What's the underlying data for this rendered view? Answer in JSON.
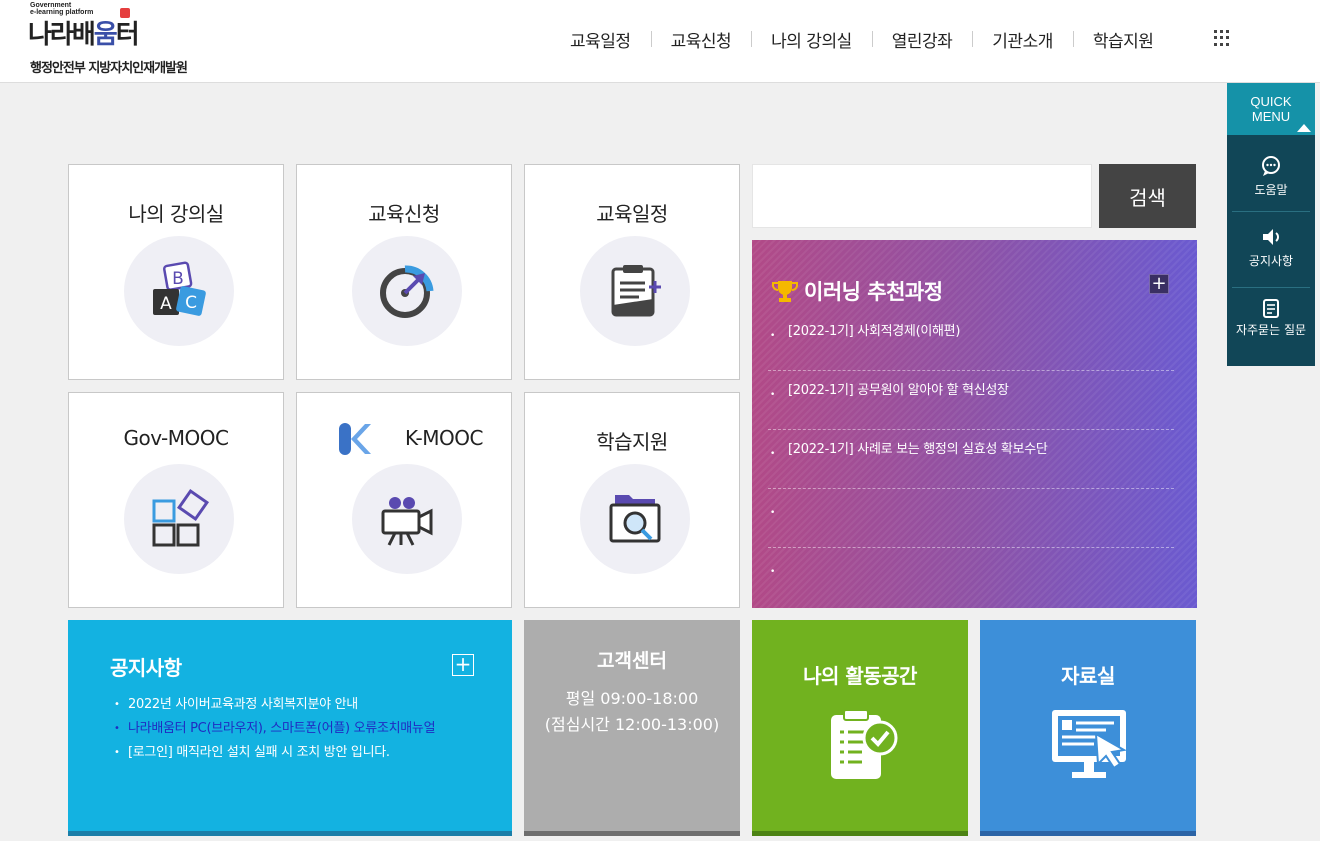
{
  "logo": {
    "sub_line1": "Government",
    "sub_line2": "e-learning platform",
    "name_part1": "나라배",
    "name_highlight": "움",
    "name_part2": "터",
    "org": "행정안전부 지방자치인재개발원"
  },
  "nav": {
    "items": [
      "교육일정",
      "교육신청",
      "나의 강의실",
      "열린강좌",
      "기관소개",
      "학습지원"
    ]
  },
  "tiles": [
    {
      "title": "나의 강의실"
    },
    {
      "title": "교육신청"
    },
    {
      "title": "교육일정"
    },
    {
      "title": "Gov-MOOC"
    },
    {
      "title": "K-MOOC"
    },
    {
      "title": "학습지원"
    }
  ],
  "abc_icon": {
    "a": "A",
    "b": "B",
    "c": "C"
  },
  "search": {
    "placeholder": "",
    "button_label": "검색"
  },
  "recommended": {
    "title": "이러닝 추천과정",
    "plus": "+",
    "items": [
      "[2022-1기] 사회적경제(이해편)",
      "[2022-1기] 공무원이 알아야 할 혁신성장",
      "[2022-1기] 사례로 보는 행정의 실효성 확보수단",
      "",
      ""
    ]
  },
  "notice": {
    "title": "공지사항",
    "plus": "+",
    "items": [
      "2022년 사이버교육과정 사회복지분야 안내",
      "나라배움터 PC(브라우저), 스마트폰(어플) 오류조치매뉴얼",
      "[로그인] 매직라인 설치 실패 시 조치 방안 입니다."
    ]
  },
  "customer_center": {
    "title": "고객센터",
    "hours_line1": "평일 09:00-18:00",
    "hours_line2": "(점심시간 12:00-13:00)"
  },
  "activity": {
    "title": "나의 활동공간"
  },
  "library": {
    "title": "자료실"
  },
  "quick_menu": {
    "title_line1": "QUICK",
    "title_line2": "MENU",
    "items": [
      "도움말",
      "공지사항",
      "자주묻는 질문"
    ]
  },
  "colors": {
    "notice_bg": "#13b2e1",
    "customer_bg": "#adadad",
    "activity_bg": "#71b21f",
    "library_bg": "#3d8fd9",
    "quickmenu_bg": "#114657",
    "quickmenu_head": "#1592a8",
    "search_btn": "#444444"
  }
}
